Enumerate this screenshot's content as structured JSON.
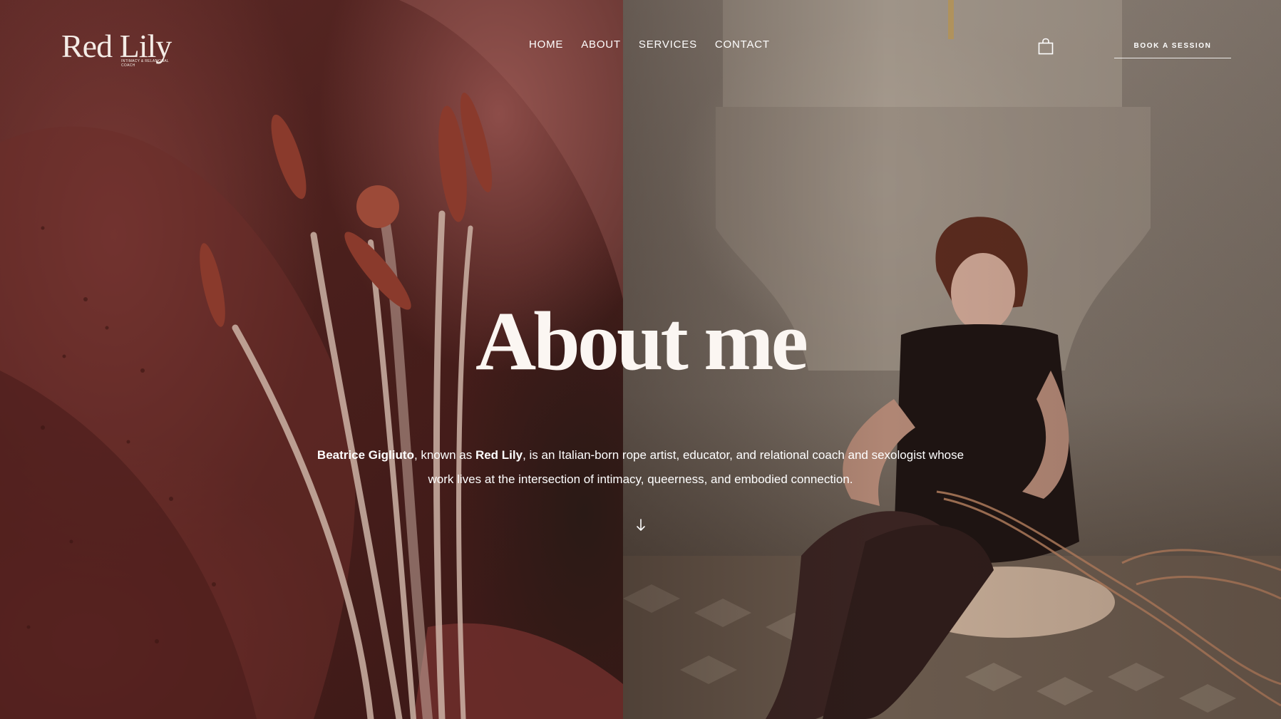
{
  "logo": {
    "wordmark": "Red Lily",
    "tagline": "INTIMACY & RELATIONAL COACH"
  },
  "nav": {
    "items": [
      {
        "label": "HOME"
      },
      {
        "label": "ABOUT"
      },
      {
        "label": "SERVICES"
      },
      {
        "label": "CONTACT"
      }
    ]
  },
  "header": {
    "cart_icon": "shopping-bag-icon",
    "book_label": "BOOK A SESSION"
  },
  "hero": {
    "title": "About me",
    "name": "Beatrice Gigliuto",
    "text_a": ", known as ",
    "alias": "Red Lily",
    "text_b": ", is an Italian-born rope artist, educator, and relational coach  and sexologist whose work lives at the intersection of intimacy, queerness, and embodied connection.",
    "scroll_icon": "arrow-down-icon"
  },
  "colors": {
    "left_tone": "#5e2a27",
    "right_tone": "#8b8076",
    "text": "#ffffff"
  }
}
